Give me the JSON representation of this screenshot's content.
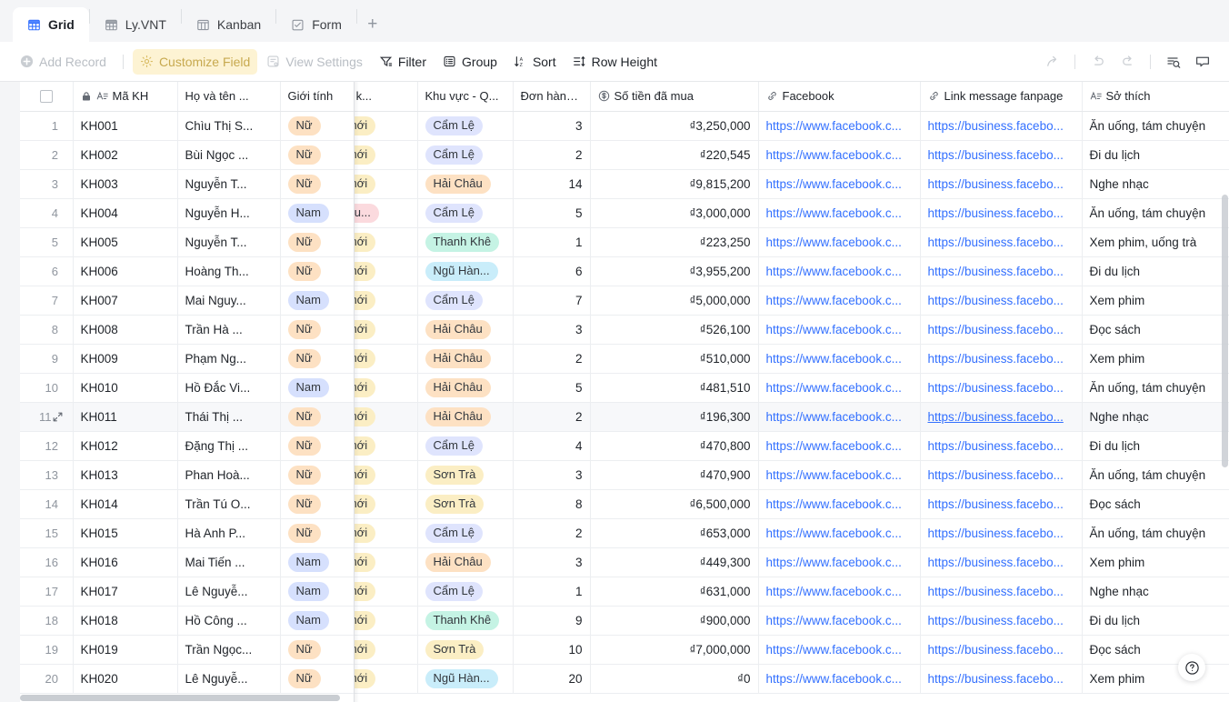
{
  "tabs": [
    {
      "label": "Grid",
      "icon": "grid-icon",
      "active": true
    },
    {
      "label": "Ly.VNT",
      "icon": "grid-icon",
      "active": false
    },
    {
      "label": "Kanban",
      "icon": "kanban-icon",
      "active": false
    },
    {
      "label": "Form",
      "icon": "form-icon",
      "active": false
    }
  ],
  "tab_add_label": "+",
  "toolbar": {
    "add_record": "Add Record",
    "customize_field": "Customize Field",
    "view_settings": "View Settings",
    "filter": "Filter",
    "group": "Group",
    "sort": "Sort",
    "row_height": "Row Height",
    "share_icon": "share-icon",
    "undo_icon": "undo-icon",
    "redo_icon": "redo-icon",
    "search_icon": "search-rows-icon",
    "comment_icon": "comment-icon",
    "highlight_color": "#fdf3d3",
    "highlight_text_color": "#c7a94f"
  },
  "grid": {
    "select_all_checkbox": "",
    "columns": [
      {
        "key": "ma",
        "label": "Mã KH",
        "icon": "text-field-icon",
        "lock": true,
        "align": "left"
      },
      {
        "key": "hoten",
        "label": "Họ và tên ...",
        "icon": "",
        "lock": false,
        "align": "left"
      },
      {
        "key": "gt",
        "label": "Giới tính",
        "icon": "",
        "lock": false,
        "align": "left"
      },
      {
        "key": "nhom",
        "label": "nhóm k...",
        "icon": "",
        "lock": false,
        "align": "left"
      },
      {
        "key": "khu",
        "label": "Khu vực - Q...",
        "icon": "",
        "lock": false,
        "align": "left"
      },
      {
        "key": "don",
        "label": "Đơn hàng...",
        "icon": "",
        "lock": false,
        "align": "left"
      },
      {
        "key": "tien",
        "label": "Số tiền đã mua",
        "icon": "currency-icon",
        "lock": false,
        "align": "left"
      },
      {
        "key": "fb",
        "label": "Facebook",
        "icon": "link-icon",
        "lock": false,
        "align": "left"
      },
      {
        "key": "link",
        "label": "Link message fanpage",
        "icon": "link-icon",
        "lock": false,
        "align": "left"
      },
      {
        "key": "so",
        "label": "Sở thích",
        "icon": "text-field-icon",
        "lock": false,
        "align": "left"
      }
    ],
    "hovered_row": 11,
    "rows": [
      {
        "n": "1",
        "ma": "KH001",
        "hoten": "Chìu Thị S...",
        "gt": "Nữ",
        "nhom": "ch mới",
        "khu": "Cẩm Lệ",
        "khu_style": "camle",
        "don": "3",
        "tien": "₫3,250,000",
        "fb": "https://www.facebook.c...",
        "link": "https://business.facebo...",
        "so": "Ăn uống, tám chuyện"
      },
      {
        "n": "2",
        "ma": "KH002",
        "hoten": "Bùi Ngọc ...",
        "gt": "Nữ",
        "nhom": "ch mới",
        "khu": "Cẩm Lệ",
        "khu_style": "camle",
        "don": "2",
        "tien": "₫220,545",
        "fb": "https://www.facebook.c...",
        "link": "https://business.facebo...",
        "so": "Đi du lịch"
      },
      {
        "n": "3",
        "ma": "KH003",
        "hoten": "Nguyễn T...",
        "gt": "Nữ",
        "nhom": "ch mới",
        "khu": "Hải Châu",
        "khu_style": "haichau",
        "don": "14",
        "tien": "₫9,815,200",
        "fb": "https://www.facebook.c...",
        "link": "https://business.facebo...",
        "so": "Nghe nhạc"
      },
      {
        "n": "4",
        "ma": "KH004",
        "hoten": "Nguyễn H...",
        "gt": "Nam",
        "nhom": "ch tru...",
        "khu": "Cẩm Lệ",
        "khu_style": "camle",
        "don": "5",
        "tien": "₫3,000,000",
        "fb": "https://www.facebook.c...",
        "link": "https://business.facebo...",
        "so": "Ăn uống, tám chuyện"
      },
      {
        "n": "5",
        "ma": "KH005",
        "hoten": "Nguyễn T...",
        "gt": "Nữ",
        "nhom": "ch mới",
        "khu": "Thanh Khê",
        "khu_style": "thanhkhe",
        "don": "1",
        "tien": "₫223,250",
        "fb": "https://www.facebook.c...",
        "link": "https://business.facebo...",
        "so": "Xem phim, uống trà"
      },
      {
        "n": "6",
        "ma": "KH006",
        "hoten": "Hoàng Th...",
        "gt": "Nữ",
        "nhom": "ch mới",
        "khu": "Ngũ Hàn...",
        "khu_style": "nguhanh",
        "don": "6",
        "tien": "₫3,955,200",
        "fb": "https://www.facebook.c...",
        "link": "https://business.facebo...",
        "so": "Đi du lịch"
      },
      {
        "n": "7",
        "ma": "KH007",
        "hoten": "Mai Nguy...",
        "gt": "Nam",
        "nhom": "ch mới",
        "khu": "Cẩm Lệ",
        "khu_style": "camle",
        "don": "7",
        "tien": "₫5,000,000",
        "fb": "https://www.facebook.c...",
        "link": "https://business.facebo...",
        "so": "Xem phim"
      },
      {
        "n": "8",
        "ma": "KH008",
        "hoten": "Trần Hà ...",
        "gt": "Nữ",
        "nhom": "ch mới",
        "khu": "Hải Châu",
        "khu_style": "haichau",
        "don": "3",
        "tien": "₫526,100",
        "fb": "https://www.facebook.c...",
        "link": "https://business.facebo...",
        "so": "Đọc sách"
      },
      {
        "n": "9",
        "ma": "KH009",
        "hoten": "Phạm Ng...",
        "gt": "Nữ",
        "nhom": "ch mới",
        "khu": "Hải Châu",
        "khu_style": "haichau",
        "don": "2",
        "tien": "₫510,000",
        "fb": "https://www.facebook.c...",
        "link": "https://business.facebo...",
        "so": "Xem phim"
      },
      {
        "n": "10",
        "ma": "KH010",
        "hoten": "Hồ Đắc Vi...",
        "gt": "Nam",
        "nhom": "ch mới",
        "khu": "Hải Châu",
        "khu_style": "haichau",
        "don": "5",
        "tien": "₫481,510",
        "fb": "https://www.facebook.c...",
        "link": "https://business.facebo...",
        "so": "Ăn uống, tám chuyện"
      },
      {
        "n": "11",
        "ma": "KH011",
        "hoten": "Thái Thị ...",
        "gt": "Nữ",
        "nhom": "ch mới",
        "khu": "Hải Châu",
        "khu_style": "haichau",
        "don": "2",
        "tien": "₫196,300",
        "fb": "https://www.facebook.c...",
        "link": "https://business.facebo...",
        "so": "Nghe nhạc"
      },
      {
        "n": "12",
        "ma": "KH012",
        "hoten": "Đặng Thị ...",
        "gt": "Nữ",
        "nhom": "ch mới",
        "khu": "Cẩm Lệ",
        "khu_style": "camle",
        "don": "4",
        "tien": "₫470,800",
        "fb": "https://www.facebook.c...",
        "link": "https://business.facebo...",
        "so": "Đi du lịch"
      },
      {
        "n": "13",
        "ma": "KH013",
        "hoten": "Phan Hoà...",
        "gt": "Nữ",
        "nhom": "ch mới",
        "khu": "Sơn Trà",
        "khu_style": "sontra",
        "don": "3",
        "tien": "₫470,900",
        "fb": "https://www.facebook.c...",
        "link": "https://business.facebo...",
        "so": "Ăn uống, tám chuyện"
      },
      {
        "n": "14",
        "ma": "KH014",
        "hoten": "Trần Tú O...",
        "gt": "Nữ",
        "nhom": "ch mới",
        "khu": "Sơn Trà",
        "khu_style": "sontra",
        "don": "8",
        "tien": "₫6,500,000",
        "fb": "https://www.facebook.c...",
        "link": "https://business.facebo...",
        "so": "Đọc sách"
      },
      {
        "n": "15",
        "ma": "KH015",
        "hoten": "Hà Anh P...",
        "gt": "Nữ",
        "nhom": "ch mới",
        "khu": "Cẩm Lệ",
        "khu_style": "camle",
        "don": "2",
        "tien": "₫653,000",
        "fb": "https://www.facebook.c...",
        "link": "https://business.facebo...",
        "so": "Ăn uống, tám chuyện"
      },
      {
        "n": "16",
        "ma": "KH016",
        "hoten": "Mai Tiến ...",
        "gt": "Nam",
        "nhom": "ch mới",
        "khu": "Hải Châu",
        "khu_style": "haichau",
        "don": "3",
        "tien": "₫449,300",
        "fb": "https://www.facebook.c...",
        "link": "https://business.facebo...",
        "so": "Xem phim"
      },
      {
        "n": "17",
        "ma": "KH017",
        "hoten": "Lê Nguyễ...",
        "gt": "Nam",
        "nhom": "ch mới",
        "khu": "Cẩm Lệ",
        "khu_style": "camle",
        "don": "1",
        "tien": "₫631,000",
        "fb": "https://www.facebook.c...",
        "link": "https://business.facebo...",
        "so": "Nghe nhạc"
      },
      {
        "n": "18",
        "ma": "KH018",
        "hoten": "Hồ Công ...",
        "gt": "Nam",
        "nhom": "ch mới",
        "khu": "Thanh Khê",
        "khu_style": "thanhkhe",
        "don": "9",
        "tien": "₫900,000",
        "fb": "https://www.facebook.c...",
        "link": "https://business.facebo...",
        "so": "Đi du lịch"
      },
      {
        "n": "19",
        "ma": "KH019",
        "hoten": "Trần Ngọc...",
        "gt": "Nữ",
        "nhom": "ch mới",
        "khu": "Sơn Trà",
        "khu_style": "sontra",
        "don": "10",
        "tien": "₫7,000,000",
        "fb": "https://www.facebook.c...",
        "link": "https://business.facebo...",
        "so": "Đọc sách"
      },
      {
        "n": "20",
        "ma": "KH020",
        "hoten": "Lê Nguyễ...",
        "gt": "Nữ",
        "nhom": "ch mới",
        "khu": "Ngũ Hàn...",
        "khu_style": "nguhanh",
        "don": "20",
        "tien": "₫0",
        "fb": "https://www.facebook.c...",
        "link": "https://business.facebo...",
        "so": "Xem phim"
      }
    ]
  },
  "help_label": "?"
}
